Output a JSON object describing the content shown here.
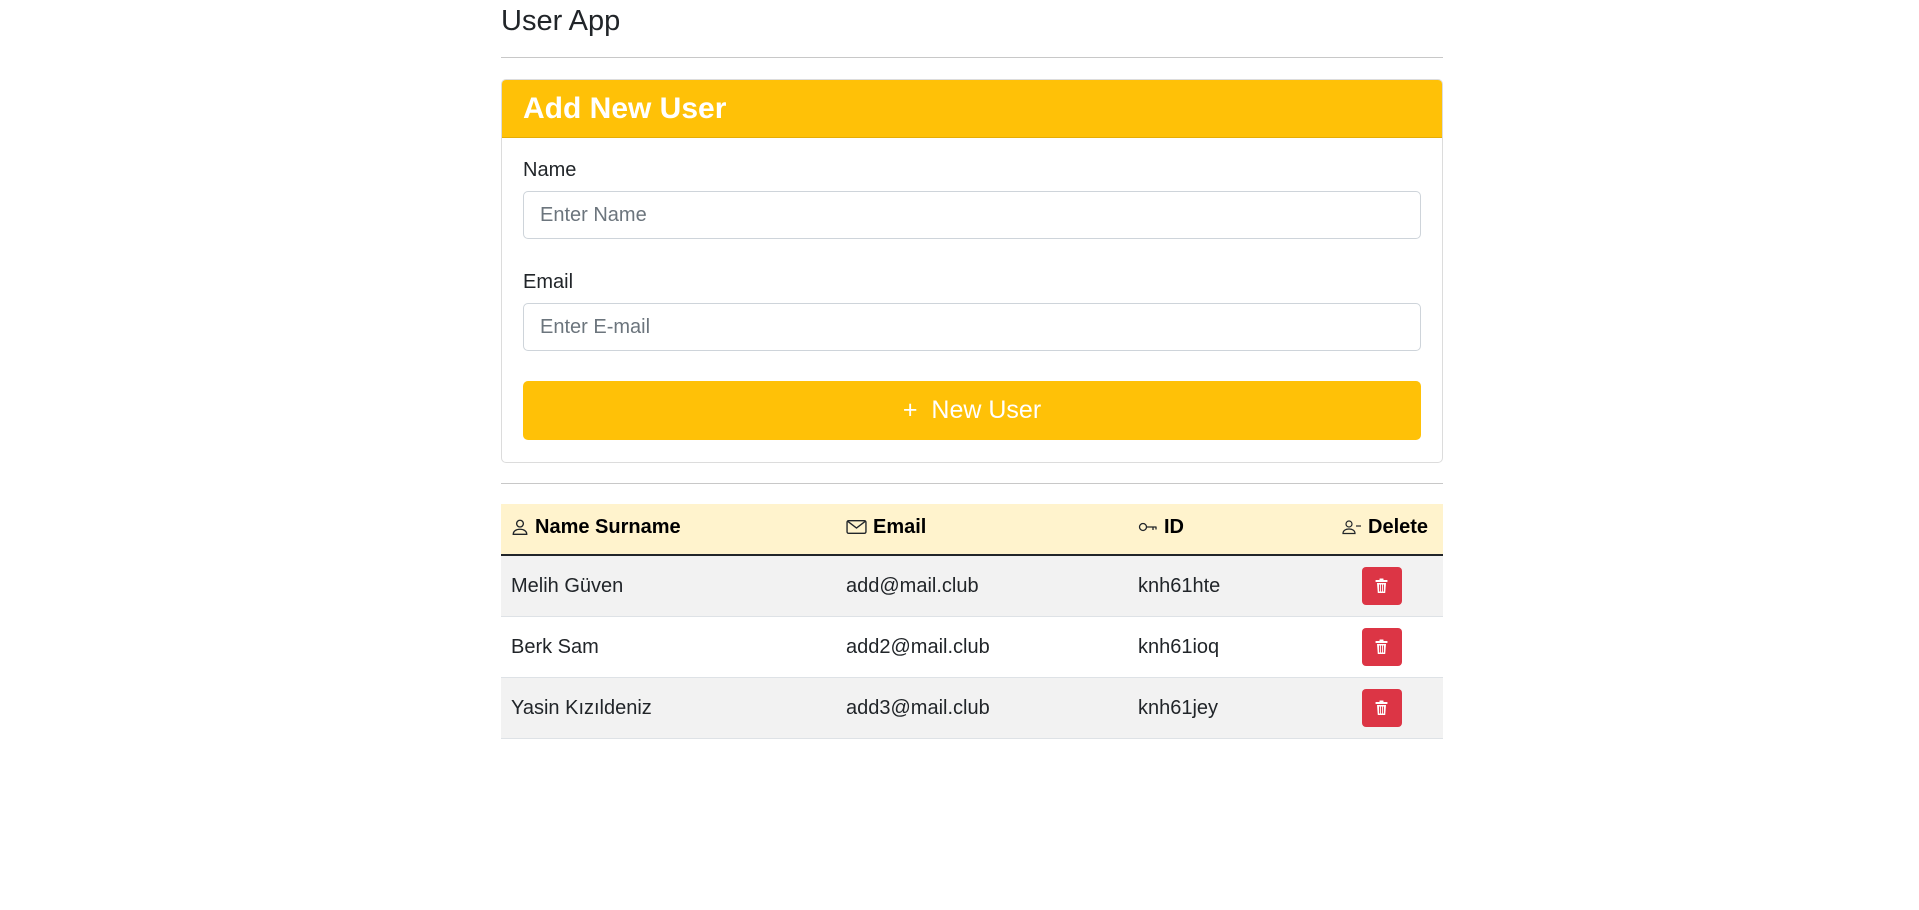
{
  "app": {
    "title": "User App"
  },
  "form": {
    "header": "Add New User",
    "name_label": "Name",
    "name_placeholder": "Enter Name",
    "email_label": "Email",
    "email_placeholder": "Enter E-mail",
    "submit_label": "New User",
    "submit_icon": "+"
  },
  "table": {
    "columns": [
      {
        "label": "Name Surname",
        "icon": "person-icon"
      },
      {
        "label": "Email",
        "icon": "envelope-icon"
      },
      {
        "label": "ID",
        "icon": "key-icon"
      },
      {
        "label": "Delete",
        "icon": "person-dash-icon"
      }
    ],
    "rows": [
      {
        "name": "Melih Güven",
        "email": "add@mail.club",
        "id": "knh61hte"
      },
      {
        "name": "Berk Sam",
        "email": "add2@mail.club",
        "id": "knh61ioq"
      },
      {
        "name": "Yasin Kızıldeniz",
        "email": "add3@mail.club",
        "id": "knh61jey"
      }
    ]
  },
  "colors": {
    "accent": "#ffc107",
    "table_header_bg": "#fff3cd",
    "danger": "#dc3545"
  }
}
